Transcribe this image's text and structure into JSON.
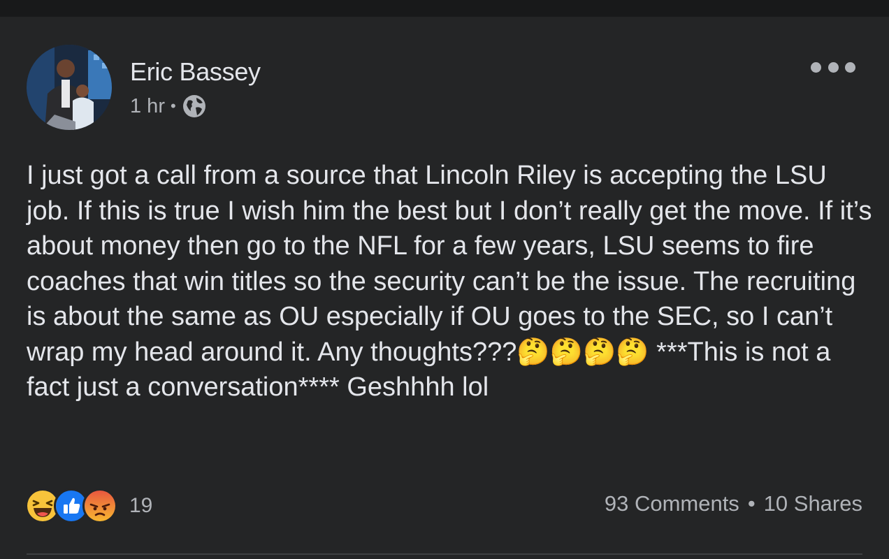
{
  "post": {
    "author": "Eric Bassey",
    "timestamp": "1 hr",
    "separator": "•",
    "privacy_icon": "globe-icon",
    "more_icon": "more-options-icon",
    "body_text": "I just got a call from a source that Lincoln Riley is accepting the LSU job. If this is true I wish him the best but I don’t really get the move. If it’s about money then go to the NFL for a few years, LSU seems to fire coaches that win titles so the security can’t be the issue. The recruiting is about the same as OU especially if OU goes to the SEC, so I can’t wrap my head around it. Any thoughts???🤔🤔🤔🤔 ***This is not a fact just a conversation**** Geshhhh lol"
  },
  "reactions": {
    "types": [
      "haha",
      "like",
      "angry"
    ],
    "count": "19"
  },
  "engagement": {
    "comments": "93 Comments",
    "dot": "•",
    "shares": "10 Shares"
  },
  "colors": {
    "background": "#242526",
    "text": "#e4e6eb",
    "secondary_text": "#b0b3b8",
    "like_blue": "#1877f2"
  }
}
